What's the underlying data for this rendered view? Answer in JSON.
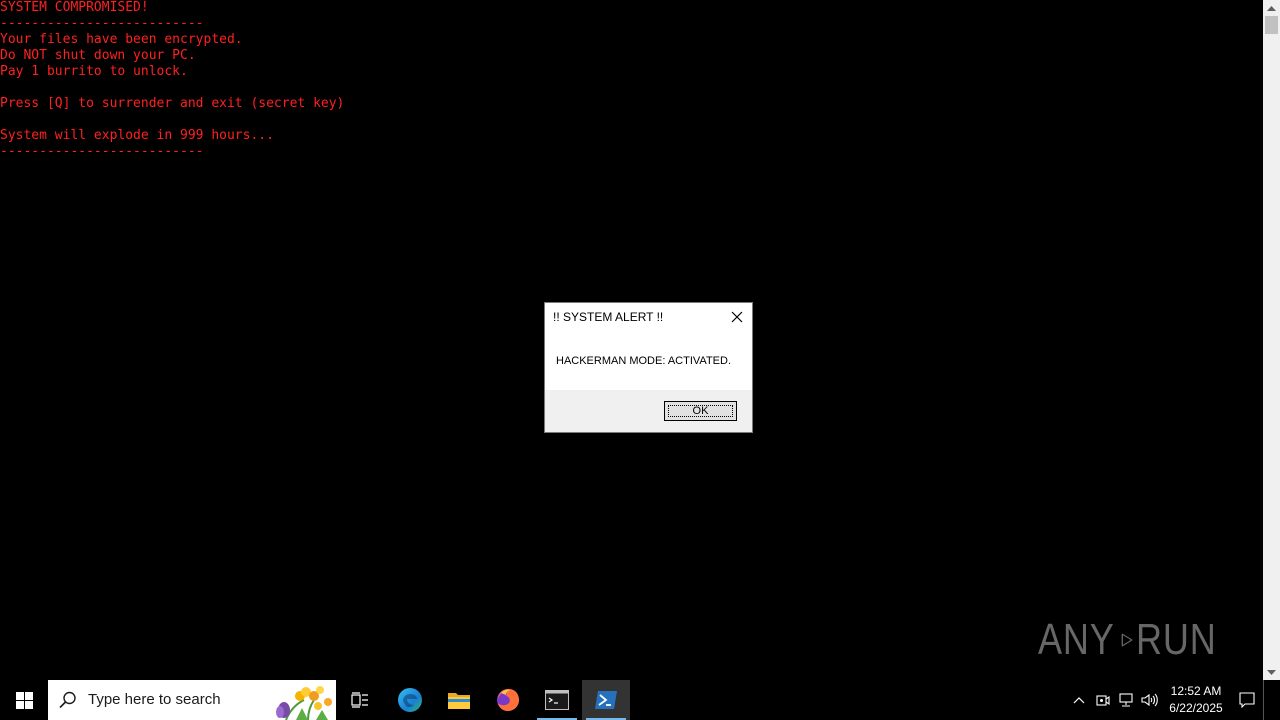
{
  "console": {
    "lines": [
      "SYSTEM COMPROMISED!",
      "--------------------------",
      "Your files have been encrypted.",
      "Do NOT shut down your PC.",
      "Pay 1 burrito to unlock.",
      "",
      "Press [Q] to surrender and exit (secret key)",
      "",
      "System will explode in 999 hours...",
      "--------------------------"
    ],
    "text_color": "#ff2020",
    "background": "#000000"
  },
  "dialog": {
    "title": "!! SYSTEM ALERT !!",
    "message": "HACKERMAN MODE: ACTIVATED.",
    "ok_label": "OK",
    "close_icon": "close-icon"
  },
  "watermark": {
    "left_text": "ANY",
    "right_text": "RUN"
  },
  "taskbar": {
    "search_placeholder": "Type here to search",
    "pinned": [
      "windows-start-icon",
      "task-view-icon",
      "edge-icon",
      "file-explorer-icon",
      "firefox-icon",
      "cmd-icon",
      "powershell-icon"
    ],
    "active_app": "powershell",
    "accent": "#76b9ed"
  },
  "tray": {
    "time": "12:52 AM",
    "date": "6/22/2025",
    "icons": [
      "chevron-up-icon",
      "meet-now-icon",
      "network-icon",
      "volume-icon",
      "notification-icon"
    ]
  }
}
